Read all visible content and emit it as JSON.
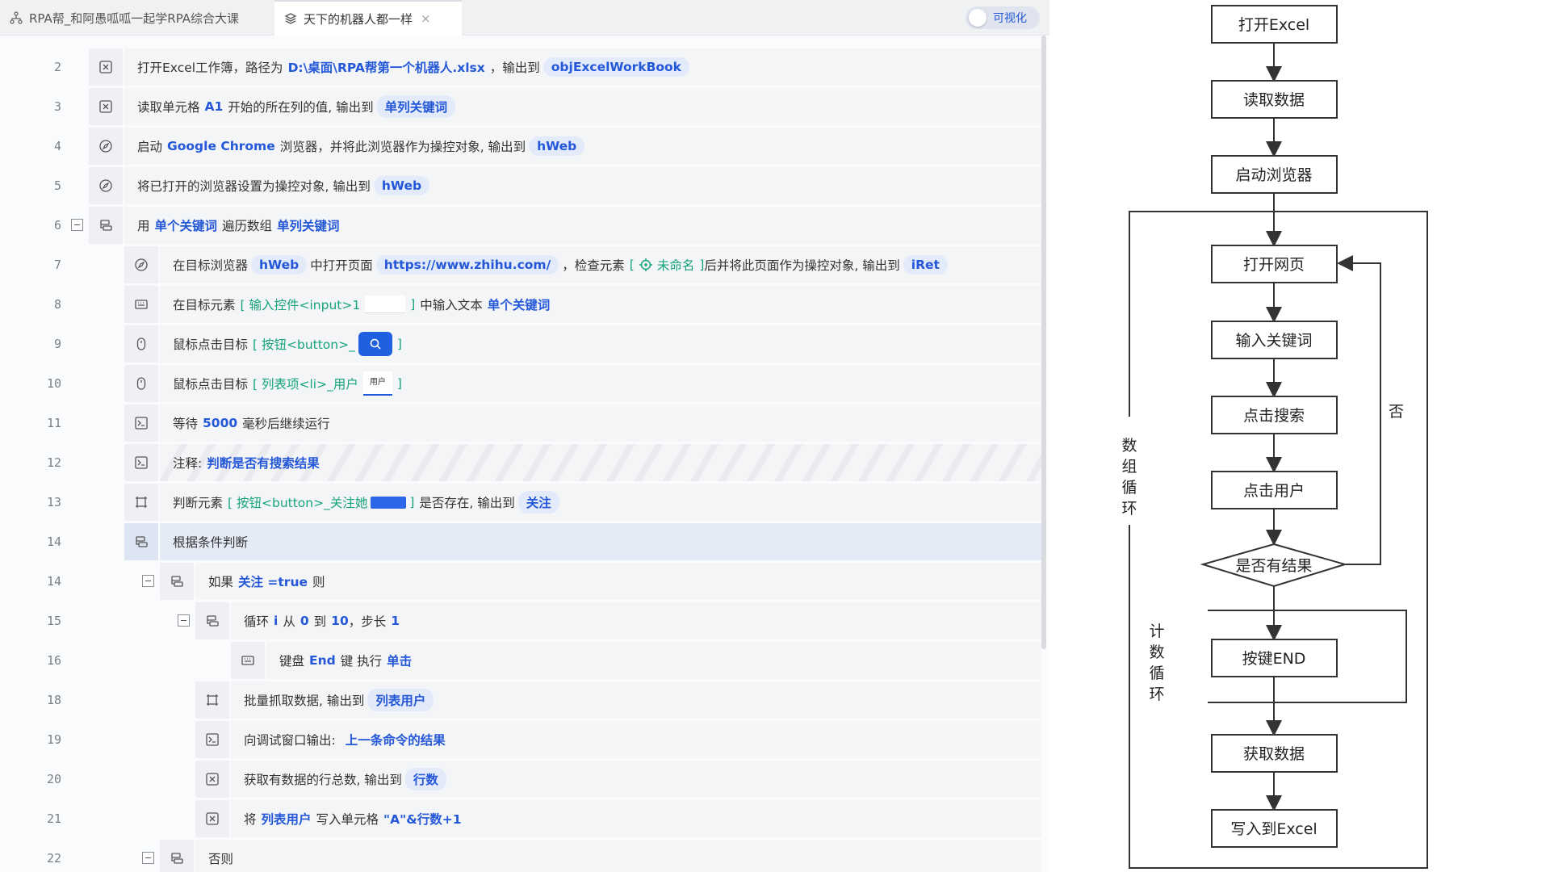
{
  "tabs": [
    {
      "label": "RPA帮_和阿愚呱呱一起学RPA综合大课"
    },
    {
      "label": "天下的机器人都一样",
      "close": "×"
    }
  ],
  "toggle": {
    "label": "可视化"
  },
  "rows": [
    {
      "line": "2",
      "seg": {
        "a": "打开Excel工作簿，路径为",
        "b": "D:\\桌面\\RPA帮第一个机器人.xlsx",
        "c": "，输出到",
        "d": "objExcelWorkBook"
      }
    },
    {
      "line": "3",
      "seg": {
        "a": "读取单元格",
        "b": "A1",
        "c": "开始的所在列的值, 输出到",
        "d": "单列关键词"
      }
    },
    {
      "line": "4",
      "seg": {
        "a": "启动",
        "b": "Google Chrome",
        "c": "浏览器，并将此浏览器作为操控对象, 输出到",
        "d": "hWeb"
      }
    },
    {
      "line": "5",
      "seg": {
        "a": "将已打开的浏览器设置为操控对象, 输出到",
        "d": "hWeb"
      }
    },
    {
      "line": "6",
      "seg": {
        "a": "用",
        "b": "单个关键词",
        "c": "遍历数组",
        "d": "单列关键词"
      }
    },
    {
      "line": "7",
      "seg": {
        "a": "在目标浏览器",
        "b": "hWeb",
        "c": "中打开页面",
        "d": "https://www.zhihu.com/",
        "e": "，检查元素",
        "f": "[",
        "g": "未命名",
        "h": "]",
        "i": "后并将此页面作为操控对象, 输出到",
        "j": "iRet"
      }
    },
    {
      "line": "8",
      "seg": {
        "a": "在目标元素",
        "b": "[ 输入控件<input>1",
        "c": "]",
        "d": "中输入文本",
        "e": "单个关键词"
      }
    },
    {
      "line": "9",
      "seg": {
        "a": "鼠标点击目标",
        "b": "[ 按钮<button>_",
        "c": "]"
      }
    },
    {
      "line": "10",
      "seg": {
        "a": "鼠标点击目标",
        "b": "[ 列表项<li>_用户",
        "c": "用户",
        "d": "]"
      }
    },
    {
      "line": "11",
      "seg": {
        "a": "等待",
        "b": "5000",
        "c": "毫秒后继续运行"
      }
    },
    {
      "line": "12",
      "seg": {
        "a": "注释:",
        "b": "判断是否有搜索结果"
      }
    },
    {
      "line": "13",
      "seg": {
        "a": "判断元素",
        "b": "[ 按钮<button>_关注她",
        "c": "]",
        "d": "是否存在, 输出到",
        "e": "关注"
      }
    },
    {
      "line": "14",
      "seg": {
        "a": "根据条件判断"
      }
    },
    {
      "line": "14",
      "seg": {
        "a": "如果",
        "b": "关注 =true",
        "c": "则"
      }
    },
    {
      "line": "15",
      "seg": {
        "a": "循环",
        "b": "i",
        "c": "从",
        "d": "0",
        "e": "到",
        "f": "10",
        "g": "，步长",
        "h": "1"
      }
    },
    {
      "line": "16",
      "seg": {
        "a": "键盘",
        "b": "End",
        "c": "键 执行",
        "d": "单击"
      }
    },
    {
      "line": "18",
      "seg": {
        "a": "批量抓取数据, 输出到",
        "b": "列表用户"
      }
    },
    {
      "line": "19",
      "seg": {
        "a": "向调试窗口输出:",
        "b": "上一条命令的结果"
      }
    },
    {
      "line": "20",
      "seg": {
        "a": "获取有数据的行总数, 输出到",
        "b": "行数"
      }
    },
    {
      "line": "21",
      "seg": {
        "a": "将",
        "b": "列表用户",
        "c": "写入单元格",
        "d": "\"A\"&行数+1"
      }
    },
    {
      "line": "22",
      "seg": {
        "a": "否则"
      }
    }
  ],
  "flowchart": {
    "nodes": [
      "打开Excel",
      "读取数据",
      "启动浏览器",
      "打开网页",
      "输入关键词",
      "点击搜索",
      "点击用户",
      "是否有结果",
      "按键END",
      "获取数据",
      "写入到Excel"
    ],
    "no_label": "否",
    "outer_loop": [
      "数",
      "组",
      "循",
      "环"
    ],
    "count_loop": [
      "计",
      "数",
      "循",
      "环"
    ]
  },
  "colors": {
    "keyword": "#2458d8",
    "element": "#16a37d",
    "pill_bg": "#e3ebfb",
    "selected_row": "#e4ebf7"
  }
}
